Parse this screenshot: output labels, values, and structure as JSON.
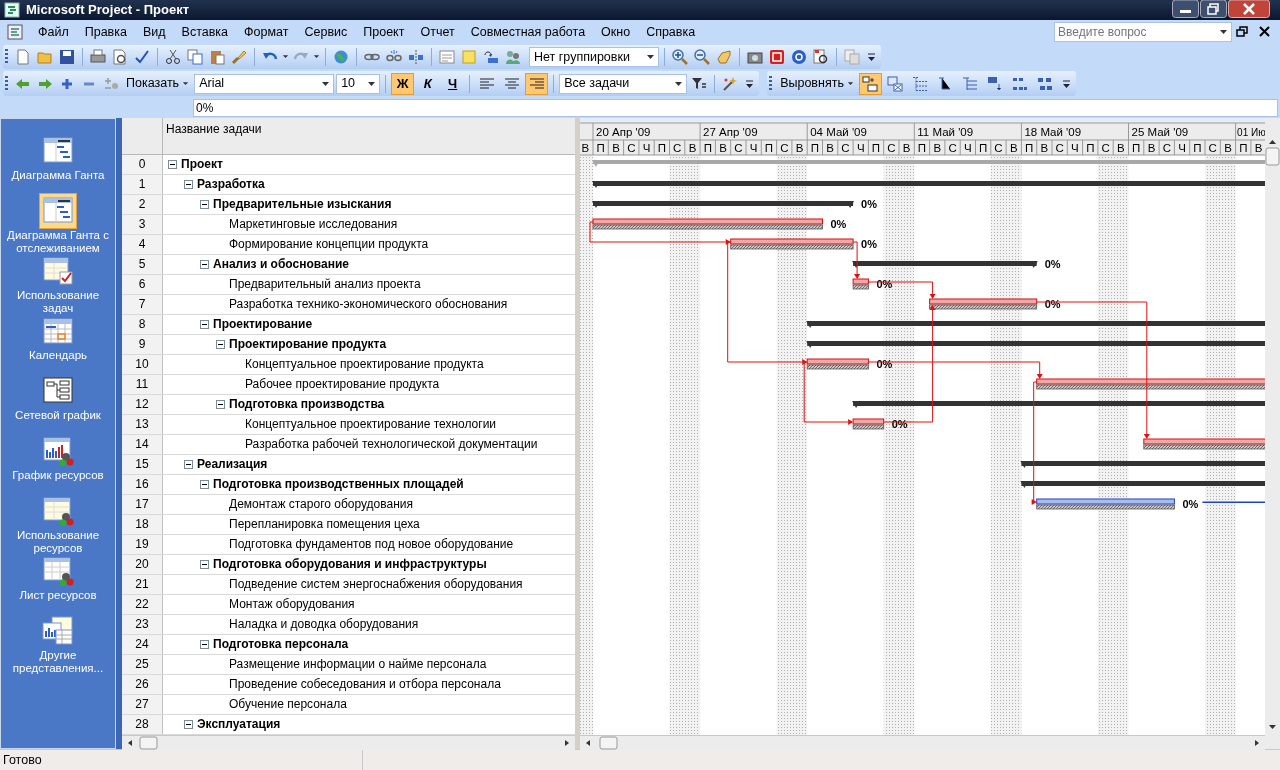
{
  "window": {
    "title": "Microsoft Project - Проект"
  },
  "menu": [
    "Файл",
    "Правка",
    "Вид",
    "Вставка",
    "Формат",
    "Сервис",
    "Проект",
    "Отчет",
    "Совместная работа",
    "Окно",
    "Справка"
  ],
  "help_search": {
    "placeholder": "Введите вопрос"
  },
  "standard_toolbar": {
    "grouping": "Нет группировки"
  },
  "formatting_toolbar": {
    "show_button": "Показать",
    "font": "Arial",
    "size": "10",
    "style_buttons": [
      {
        "label": "Ж",
        "kind": "bold",
        "on": true
      },
      {
        "label": "К",
        "kind": "italic",
        "on": false
      },
      {
        "label": "Ч",
        "kind": "underline",
        "on": false
      }
    ],
    "align": [
      {
        "kind": "left",
        "on": false
      },
      {
        "kind": "center",
        "on": false
      },
      {
        "kind": "right",
        "on": true
      }
    ],
    "filter": "Все задачи"
  },
  "network_toolbar": {
    "align_button": "Выровнять",
    "tools": [
      {
        "on": true
      },
      {
        "on": false
      },
      {
        "on": false
      },
      {
        "on": false
      },
      {
        "on": false
      },
      {
        "on": false
      },
      {
        "on": false
      },
      {
        "on": false
      }
    ]
  },
  "entry_bar": {
    "value": "0%"
  },
  "view_bar": {
    "items": [
      {
        "label": "Диаграмма Ганта",
        "selected": false
      },
      {
        "label": "Диаграмма Ганта с отслеживанием",
        "selected": true
      },
      {
        "label": "Использование задач",
        "selected": false
      },
      {
        "label": "Календарь",
        "selected": false
      },
      {
        "label": "Сетевой график",
        "selected": false
      },
      {
        "label": "График ресурсов",
        "selected": false
      },
      {
        "label": "Использование ресурсов",
        "selected": false
      },
      {
        "label": "Лист ресурсов",
        "selected": false
      },
      {
        "label": "Другие представления...",
        "selected": false
      }
    ]
  },
  "table": {
    "columns": [
      "Название задачи"
    ],
    "tasks": [
      {
        "id": "0",
        "name": "Проект",
        "expanded": true,
        "bar": {
          "kind": "project_summary"
        },
        "children": [
          {
            "id": "1",
            "name": "Разработка",
            "expanded": true,
            "bar": {
              "kind": "summary"
            },
            "children": [
              {
                "id": "2",
                "name": "Предварительные изыскания",
                "expanded": true,
                "bar": {
                  "kind": "summary",
                  "label": "0%"
                },
                "children": [
                  {
                    "id": "3",
                    "name": "Маркетинговые исследования",
                    "bar": {
                      "kind": "critical",
                      "label": "0%"
                    }
                  },
                  {
                    "id": "4",
                    "name": "Формирование концепции продукта",
                    "bar": {
                      "kind": "critical",
                      "label": "0%"
                    }
                  }
                ]
              },
              {
                "id": "5",
                "name": "Анализ и обоснование",
                "expanded": true,
                "bar": {
                  "kind": "summary",
                  "label": "0%"
                },
                "children": [
                  {
                    "id": "6",
                    "name": "Предварительный анализ проекта",
                    "bar": {
                      "kind": "critical",
                      "label": "0%"
                    }
                  },
                  {
                    "id": "7",
                    "name": "Разработка технико-экономического обоснования",
                    "bar": {
                      "kind": "critical",
                      "label": "0%"
                    }
                  }
                ]
              },
              {
                "id": "8",
                "name": "Проектирование",
                "expanded": true,
                "bar": {
                  "kind": "summary"
                },
                "children": [
                  {
                    "id": "9",
                    "name": "Проектирование продукта",
                    "expanded": true,
                    "bar": {
                      "kind": "summary"
                    },
                    "children": [
                      {
                        "id": "10",
                        "name": "Концептуальное проектирование продукта",
                        "bar": {
                          "kind": "critical",
                          "label": "0%"
                        }
                      },
                      {
                        "id": "11",
                        "name": "Рабочее проектирование продукта",
                        "bar": {
                          "kind": "critical"
                        }
                      }
                    ]
                  },
                  {
                    "id": "12",
                    "name": "Подготовка производства",
                    "expanded": true,
                    "bar": {
                      "kind": "summary"
                    },
                    "children": [
                      {
                        "id": "13",
                        "name": "Концептуальное проектирование технологии",
                        "bar": {
                          "kind": "critical",
                          "label": "0%"
                        }
                      },
                      {
                        "id": "14",
                        "name": "Разработка рабочей технологической документации",
                        "bar": {
                          "kind": "critical"
                        }
                      }
                    ]
                  }
                ]
              }
            ]
          },
          {
            "id": "15",
            "name": "Реализация",
            "expanded": true,
            "bar": {
              "kind": "summary"
            },
            "children": [
              {
                "id": "16",
                "name": "Подготовка производственных площадей",
                "expanded": true,
                "bar": {
                  "kind": "summary"
                },
                "children": [
                  {
                    "id": "17",
                    "name": "Демонтаж старого оборудования",
                    "bar": {
                      "kind": "task",
                      "slack": true,
                      "label": "0%"
                    }
                  },
                  {
                    "id": "18",
                    "name": "Перепланировка помещения цеха"
                  },
                  {
                    "id": "19",
                    "name": "Подготовка фундаментов под новое оборудование"
                  }
                ]
              },
              {
                "id": "20",
                "name": "Подготовка оборудования и инфраструктуры",
                "expanded": true,
                "children": [
                  {
                    "id": "21",
                    "name": "Подведение систем энергоснабжения оборудования"
                  },
                  {
                    "id": "22",
                    "name": "Монтаж оборудования"
                  },
                  {
                    "id": "23",
                    "name": "Наладка и доводка оборудования"
                  }
                ]
              },
              {
                "id": "24",
                "name": "Подготовка персонала",
                "expanded": true,
                "children": [
                  {
                    "id": "25",
                    "name": "Размещение информации о найме персонала"
                  },
                  {
                    "id": "26",
                    "name": "Проведение собеседования и отбора персонала"
                  },
                  {
                    "id": "27",
                    "name": "Обучение персонала"
                  }
                ]
              }
            ]
          },
          {
            "id": "28",
            "name": "Эксплуатация",
            "expanded": true
          }
        ]
      }
    ]
  },
  "timeline": {
    "weeks": [
      "20 Апр '09",
      "27 Апр '09",
      "04 Май '09",
      "11 Май '09",
      "18 Май '09",
      "25 Май '09",
      "01 Ию"
    ],
    "days": [
      {
        "label": "В",
        "weekend": true
      },
      {
        "label": "П",
        "weekend": false
      },
      {
        "label": "В",
        "weekend": false
      },
      {
        "label": "С",
        "weekend": false
      },
      {
        "label": "Ч",
        "weekend": false
      },
      {
        "label": "П",
        "weekend": false
      },
      {
        "label": "С",
        "weekend": true
      },
      {
        "label": "В",
        "weekend": true
      },
      {
        "label": "П",
        "weekend": false
      },
      {
        "label": "В",
        "weekend": false
      },
      {
        "label": "С",
        "weekend": false
      },
      {
        "label": "Ч",
        "weekend": false
      },
      {
        "label": "П",
        "weekend": false
      },
      {
        "label": "С",
        "weekend": true
      },
      {
        "label": "В",
        "weekend": true
      },
      {
        "label": "П",
        "weekend": false
      },
      {
        "label": "В",
        "weekend": false
      },
      {
        "label": "С",
        "weekend": false
      },
      {
        "label": "Ч",
        "weekend": false
      },
      {
        "label": "П",
        "weekend": false
      },
      {
        "label": "С",
        "weekend": true
      },
      {
        "label": "В",
        "weekend": true
      },
      {
        "label": "П",
        "weekend": false
      },
      {
        "label": "В",
        "weekend": false
      },
      {
        "label": "С",
        "weekend": false
      },
      {
        "label": "Ч",
        "weekend": false
      },
      {
        "label": "П",
        "weekend": false
      },
      {
        "label": "С",
        "weekend": true
      },
      {
        "label": "В",
        "weekend": true
      },
      {
        "label": "П",
        "weekend": false
      },
      {
        "label": "В",
        "weekend": false
      },
      {
        "label": "С",
        "weekend": false
      },
      {
        "label": "Ч",
        "weekend": false
      },
      {
        "label": "П",
        "weekend": false
      },
      {
        "label": "С",
        "weekend": true
      },
      {
        "label": "В",
        "weekend": true
      },
      {
        "label": "П",
        "weekend": false
      },
      {
        "label": "В",
        "weekend": false
      },
      {
        "label": "С",
        "weekend": false
      },
      {
        "label": "Ч",
        "weekend": false
      },
      {
        "label": "П",
        "weekend": false
      },
      {
        "label": "С",
        "weekend": true
      },
      {
        "label": "В",
        "weekend": true
      },
      {
        "label": "П",
        "weekend": false
      },
      {
        "label": "В",
        "weekend": false
      }
    ]
  },
  "status_bar": {
    "text": "Готово"
  }
}
